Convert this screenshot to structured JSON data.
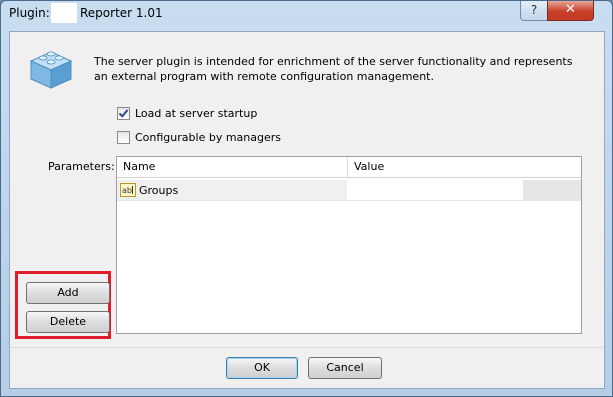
{
  "window": {
    "title_label": "Plugin:",
    "title_name": "Reporter 1.01",
    "help_label": "?",
    "close_label": "✕"
  },
  "header": {
    "icon": "plugin-puzzle-icon",
    "description": "The server plugin is intended for enrichment of the server functionality and represents an external program with remote configuration management."
  },
  "options": {
    "load_at_startup": {
      "label": "Load at server startup",
      "checked": true
    },
    "configurable_by_managers": {
      "label": "Configurable by managers",
      "checked": false
    }
  },
  "parameters": {
    "label": "Parameters:",
    "columns": [
      "Name",
      "Value"
    ],
    "rows": [
      {
        "icon": "string-type-icon",
        "name": "Groups",
        "value": ""
      }
    ],
    "add_label": "Add",
    "delete_label": "Delete"
  },
  "footer": {
    "ok_label": "OK",
    "cancel_label": "Cancel"
  },
  "colors": {
    "highlight": "#e01e2b",
    "titlebar": "#c9ddf1"
  }
}
